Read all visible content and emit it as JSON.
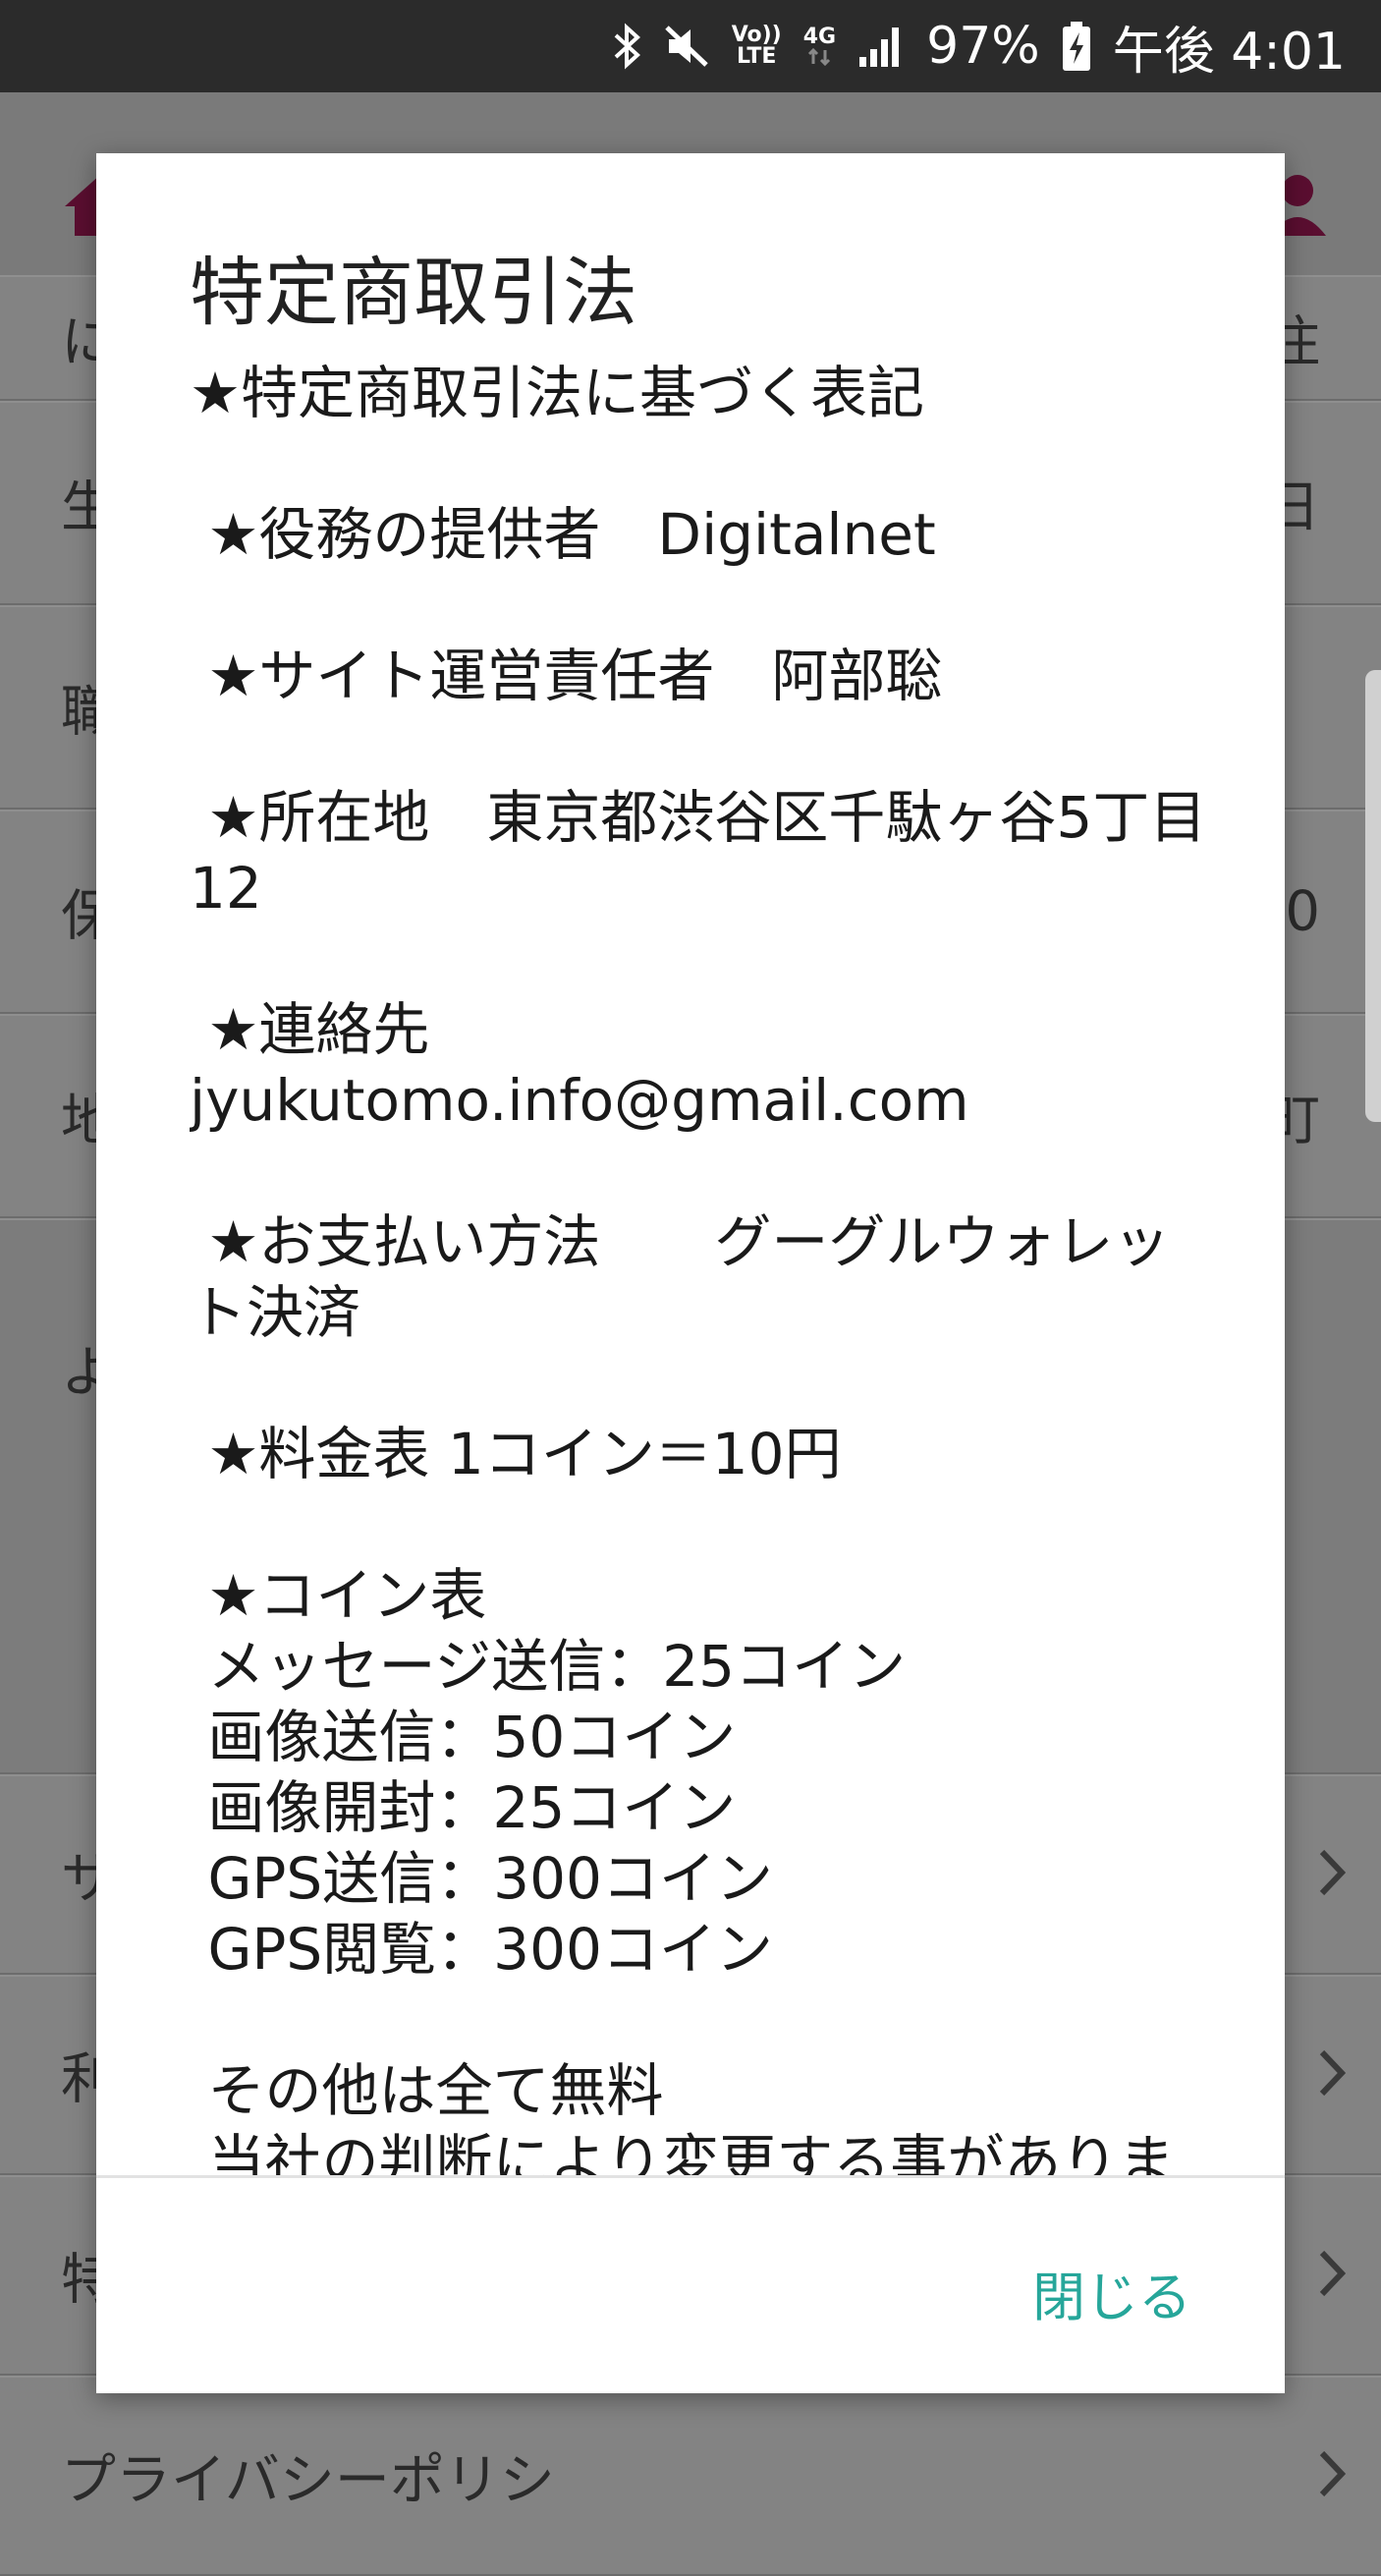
{
  "status_bar": {
    "icons": [
      "bluetooth-icon",
      "mute-icon",
      "volte-icon",
      "4g-icon",
      "signal-icon",
      "battery-charging-icon"
    ],
    "volte_top": "Vo))",
    "volte_bottom": "LTE",
    "network_type": "4G",
    "battery_percent": "97%",
    "time": "午後 4:01"
  },
  "background": {
    "rows": [
      {
        "left": "に",
        "right": "住"
      },
      {
        "left": "生",
        "right": "日"
      },
      {
        "left": "職",
        "right": ""
      },
      {
        "left": "保",
        "right": "0"
      },
      {
        "left": "地",
        "right": "町"
      },
      {
        "left": "よ",
        "right": ""
      },
      {
        "left": "サ",
        "right": ""
      },
      {
        "left": "利",
        "right": ""
      },
      {
        "left": "特",
        "right": ""
      },
      {
        "left": "プライバシーポリシ",
        "right": ""
      }
    ]
  },
  "dialog": {
    "title": "特定商取引法",
    "body": "★特定商取引法に基づく表記\n\n ★役務の提供者　Digitalnet\n\n ★サイト運営責任者　阿部聡\n\n ★所在地　東京都渋谷区千駄ヶ谷5丁目12\n\n ★連絡先\njyukutomo.info@gmail.com\n\n ★お支払い方法　　グーグルウォレット決済\n\n ★料金表 1コイン＝10円\n\n ★コイン表\n メッセージ送信：25コイン\n 画像送信：50コイン\n 画像開封：25コイン\n GPS送信：300コイン\n GPS閲覧：300コイン\n\n その他は全て無料\n 当社の判断により変更する事があります",
    "close_label": "閉じる"
  },
  "colors": {
    "accent": "#26a69a",
    "brand": "#b0175a",
    "dialog_bg": "#ffffff",
    "status_bar_bg": "#2b2b2b"
  }
}
